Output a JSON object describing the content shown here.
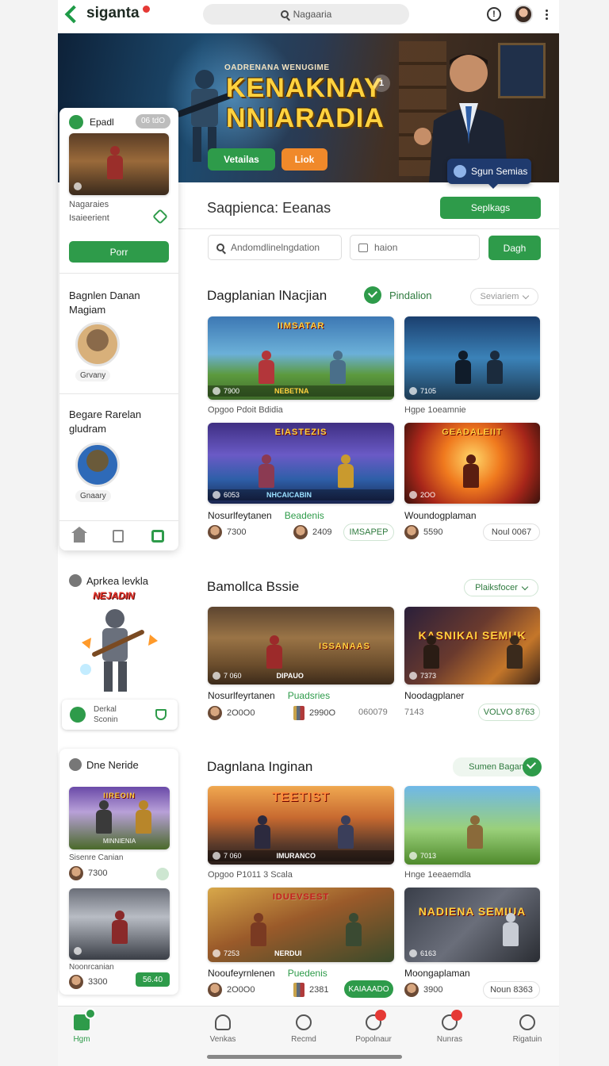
{
  "app": {
    "logo_text": "siganta",
    "search_text": "Nagaaria",
    "colors": {
      "accent": "#2e9b4a",
      "orange": "#f0892a",
      "badge": "#e53935",
      "navy": "#1f3a6e"
    }
  },
  "hero": {
    "subtitle": "OADRENANA WENUGIME",
    "title_line1": "KENAKNAY",
    "title_line2": "NNIARADIA",
    "btn_primary": "Vetailas",
    "btn_secondary": "Liok",
    "slide_number": "1",
    "signin_label": "Sgun Semias"
  },
  "main": {
    "title": "Saqpienca: Eeanas",
    "title_button": "Seplkags",
    "filter_placeholder": "Andomdlinelngdation",
    "filter_date": "haion",
    "filter_button": "Dagh"
  },
  "section1": {
    "title": "Dagplanian lNacjian",
    "badge_label": "Pindalion",
    "dropdown": "Seviariem",
    "cards": [
      {
        "art": "IIMSATAR",
        "foot_left": "7900",
        "foot_center": "NEBETNA",
        "caption": "Opgoo Pdoit Bdidia"
      },
      {
        "art": "",
        "foot_left": "7105",
        "foot_center": "",
        "caption": "Hgpe 1oeamnie"
      },
      {
        "art": "EIASTEZIS",
        "foot_left": "6053",
        "foot_center": "NHCAICABIN",
        "title": "Nosurlfeytanen",
        "tag": "Beadenis"
      },
      {
        "art": "GEADALEIIT",
        "foot_left": "2OO",
        "foot_center": "",
        "title": "Woundogplaman"
      }
    ],
    "meta": [
      {
        "value": "7300"
      },
      {
        "value": "2409"
      },
      {
        "value": "5590"
      }
    ],
    "pill_a": "IMSAPEP",
    "pill_b": "Noul 0067"
  },
  "section2": {
    "title": "Bamollca Bssie",
    "dropdown": "Plaiksfocer",
    "cards": [
      {
        "art": "ISSANAAS",
        "foot_left": "7 060",
        "foot_center": "DIPAUO"
      },
      {
        "art": "KASNIKAI SEMUK",
        "foot_left": "7373",
        "foot_center": ""
      }
    ],
    "row_title_a": "Nosurlfeyrtanen",
    "row_tag_a": "Puadsries",
    "row_title_b": "Noodagplaner",
    "meta_a": "2O0O0",
    "meta_b": "2990O",
    "meta_c": "060079",
    "meta_d": "7143",
    "pill": "VOLVO 8763"
  },
  "section3": {
    "title": "Dagnlana Inginan",
    "toggle": "Sumen Bagan",
    "cards": [
      {
        "art": "TEETIST",
        "foot_left": "7 060",
        "foot_center": "IMURANCO",
        "caption": "Opgoo P1011 3 Scala"
      },
      {
        "art": "",
        "foot_left": "7013",
        "foot_center": "",
        "caption": "Hnge 1eeaemdla"
      },
      {
        "art": "IDUEVSEST",
        "foot_left": "7253",
        "foot_center": "NERDUI"
      },
      {
        "art": "NADIENA SEMIUA",
        "foot_left": "6163",
        "foot_center": ""
      }
    ],
    "row_title_a": "Nooufeyrnlenen",
    "row_tag_a": "Puedenis",
    "row_title_b": "Moongaplaman",
    "meta_a": "2O0O0",
    "meta_b": "2381",
    "meta_c": "3900",
    "pill_a": "KAIAAADO",
    "pill_b": "Noun 8363"
  },
  "sidepanel": {
    "head_label": "Epadl",
    "head_pill": "06 tdO",
    "line1": "Nagaraies",
    "line2": "Isaieerient",
    "btn": "Porr",
    "block1_title": "Bagnlen Danan Magiam",
    "block1_label": "Grvany",
    "block2_title": "Begare Rarelan gludram",
    "block2_label": "Gnaary"
  },
  "leftcol": {
    "head1": "Aprkea levkla",
    "art_banner": "NEJADIN",
    "credits_line1": "Derkal",
    "credits_line2": "Sconin",
    "head2": "Dne Neride",
    "card1_title": "IIREOIN",
    "card1_foot": "MINNIENIA",
    "card1_caption": "Sisenre Canian",
    "card1_meta": "7300",
    "card2_caption": "Noonrcanian",
    "card2_meta": "3300",
    "card2_btn": "56.40"
  },
  "bottomnav": [
    {
      "label": "Hgm"
    },
    {
      "label": "Venkas"
    },
    {
      "label": "Recmd"
    },
    {
      "label": "Popolnaur"
    },
    {
      "label": "Nunras"
    },
    {
      "label": "Rigatuin"
    }
  ]
}
